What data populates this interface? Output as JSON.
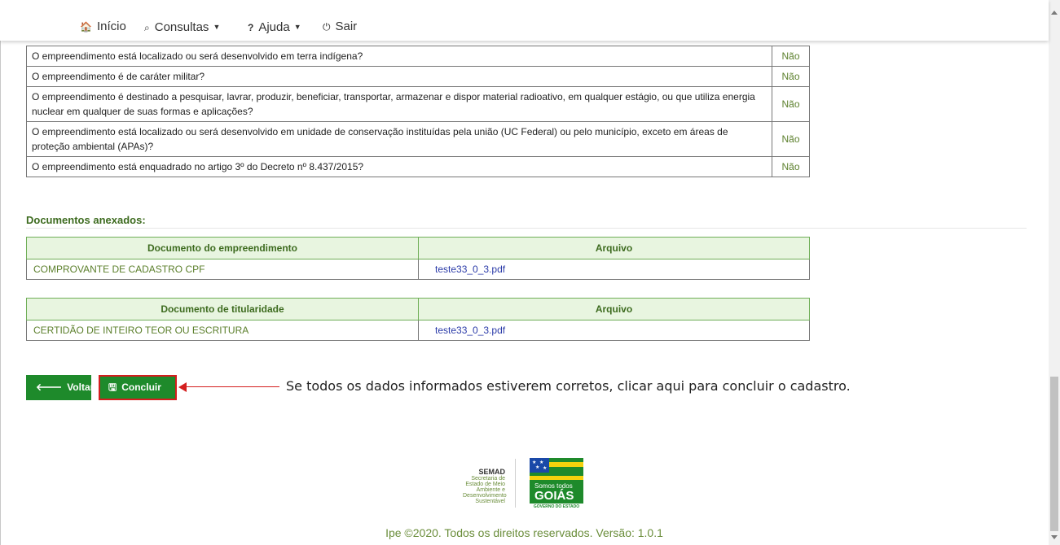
{
  "nav": {
    "items": [
      {
        "icon": "home-icon",
        "glyph": "🏠",
        "label": "Início"
      },
      {
        "icon": "search-icon",
        "glyph": "⌕",
        "label": "Consultas"
      },
      {
        "icon": "question-icon",
        "glyph": "?",
        "label": "Ajuda"
      },
      {
        "icon": "power-icon",
        "glyph": "⏻",
        "label": "Sair"
      }
    ]
  },
  "questions": [
    {
      "text": "O empreendimento está localizado ou será desenvolvido em terra indígena?",
      "answer": "Não"
    },
    {
      "text": "O empreendimento é de caráter militar?",
      "answer": "Não"
    },
    {
      "text": "O empreendimento é destinado a pesquisar, lavrar, produzir, beneficiar, transportar, armazenar e dispor material radioativo, em qualquer estágio, ou que utiliza energia nuclear em qualquer de suas formas e aplicações?",
      "answer": "Não"
    },
    {
      "text": "O empreendimento está localizado ou será desenvolvido em unidade de conservação instituídas pela união (UC Federal) ou pelo município, exceto em áreas de proteção ambiental (APAs)?",
      "answer": "Não"
    },
    {
      "text": "O empreendimento está enquadrado no artigo 3º do Decreto nº 8.437/2015?",
      "answer": "Não"
    }
  ],
  "documents": {
    "title": "Documentos anexados:",
    "tables": [
      {
        "header_doc": "Documento do empreendimento",
        "header_file": "Arquivo",
        "doc": "COMPROVANTE DE CADASTRO CPF",
        "file": "teste33_0_3.pdf"
      },
      {
        "header_doc": "Documento de titularidade",
        "header_file": "Arquivo",
        "doc": "CERTIDÃO DE INTEIRO TEOR OU ESCRITURA",
        "file": "teste33_0_3.pdf"
      }
    ]
  },
  "buttons": {
    "back_label": "Voltar",
    "conclude_label": "Concluir"
  },
  "annotation": "Se todos os dados informados estiverem corretos, clicar aqui para concluir o cadastro.",
  "logos": {
    "semad_title": "SEMAD",
    "semad_text": "Secretaria de Estado de Meio Ambiente e Desenvolvimento Sustentável",
    "goias_line1": "Somos todos",
    "goias_line2": "GOIÁS",
    "goias_line3": "GOVERNO DO ESTADO"
  },
  "footer": "Ipe ©2020. Todos os direitos reservados. Versão: 1.0.1",
  "colors": {
    "primary_green": "#1e8a2b",
    "annotation_red": "#d41e1e",
    "link_blue": "#2a3aa8"
  }
}
